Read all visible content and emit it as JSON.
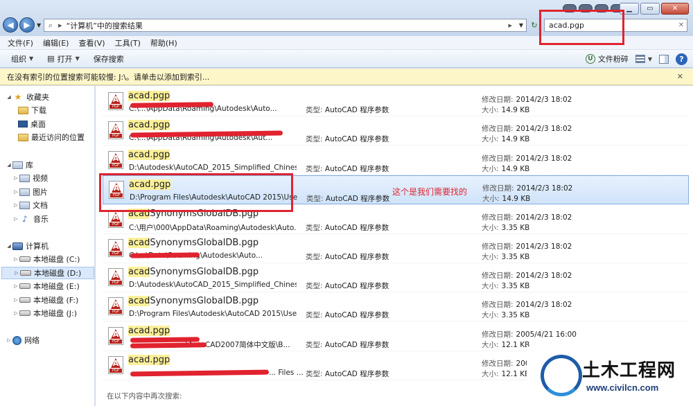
{
  "address": {
    "path": "“计算机”中的搜索结果"
  },
  "search": {
    "value": "acad.pgp"
  },
  "menu": [
    "文件(F)",
    "编辑(E)",
    "查看(V)",
    "工具(T)",
    "帮助(H)"
  ],
  "toolbar": {
    "organize": "组织",
    "open": "打开",
    "save_search": "保存搜索",
    "shredder": "文件粉碎"
  },
  "infobar": {
    "text": "在没有索引的位置搜索可能较慢: J:\\。请单击以添加到索引..."
  },
  "nav": {
    "favorites": "收藏夹",
    "downloads": "下载",
    "desktop": "桌面",
    "recent": "最近访问的位置",
    "libraries": "库",
    "videos": "视频",
    "pictures": "图片",
    "documents": "文档",
    "music": "音乐",
    "computer": "计算机",
    "drive_c": "本地磁盘 (C:)",
    "drive_d": "本地磁盘 (D:)",
    "drive_e": "本地磁盘 (E:)",
    "drive_f": "本地磁盘 (F:)",
    "drive_j": "本地磁盘 (J:)",
    "network": "网络"
  },
  "labels": {
    "type": "类型:",
    "modified": "修改日期:",
    "size": "大小:"
  },
  "results": [
    {
      "name_hl": "acad.pgp",
      "name_rest": "",
      "path": "C:\\...\\AppData\\Roaming\\Autodesk\\Auto...",
      "type": "AutoCAD 程序参数",
      "modified": "2014/2/3 18:02",
      "size": "14.9 KB"
    },
    {
      "name_hl": "acad.pgp",
      "name_rest": "",
      "path": "C:\\...\\AppData\\Roaming\\Autodesk\\Aut...",
      "type": "AutoCAD 程序参数",
      "modified": "2014/2/3 18:02",
      "size": "14.9 KB"
    },
    {
      "name_hl": "acad.pgp",
      "name_rest": "",
      "path": "D:\\Autodesk\\AutoCAD_2015_Simplified_Chinese...",
      "type": "AutoCAD 程序参数",
      "modified": "2014/2/3 18:02",
      "size": "14.9 KB"
    },
    {
      "name_hl": "acad.pgp",
      "name_rest": "",
      "path": "D:\\Program Files\\Autodesk\\AutoCAD 2015\\Use...",
      "type": "AutoCAD 程序参数",
      "modified": "2014/2/3 18:02",
      "size": "14.9 KB"
    },
    {
      "name_hl": "acad",
      "name_rest": "SynonymsGlobalDB.pgp",
      "path": "C:\\用户\\000\\AppData\\Roaming\\Autodesk\\Auto...",
      "type": "AutoCAD 程序参数",
      "modified": "2014/2/3 18:02",
      "size": "3.35 KB"
    },
    {
      "name_hl": "acad",
      "name_rest": "SynonymsGlobalDB.pgp",
      "path": "C:\\...\\Data\\Roaming\\Autodesk\\Auto...",
      "type": "AutoCAD 程序参数",
      "modified": "2014/2/3 18:02",
      "size": "3.35 KB"
    },
    {
      "name_hl": "acad",
      "name_rest": "SynonymsGlobalDB.pgp",
      "path": "D:\\Autodesk\\AutoCAD_2015_Simplified_Chinese...",
      "type": "AutoCAD 程序参数",
      "modified": "2014/2/3 18:02",
      "size": "3.35 KB"
    },
    {
      "name_hl": "acad",
      "name_rest": "SynonymsGlobalDB.pgp",
      "path": "D:\\Program Files\\Autodesk\\AutoCAD 2015\\Use...",
      "type": "AutoCAD 程序参数",
      "modified": "2014/2/3 18:02",
      "size": "3.35 KB"
    },
    {
      "name_hl": "acad.pgp",
      "name_rest": "",
      "path": "...\\AutoCAD2007简体中文版\\B...",
      "type": "AutoCAD 程序参数",
      "modified": "2005/4/21 16:00",
      "size": "12.1 KB"
    },
    {
      "name_hl": "acad.pgp",
      "name_rest": "",
      "path": "... Files ...",
      "type": "AutoCAD 程序参数",
      "modified": "200...",
      "size": "12.1 KB"
    }
  ],
  "annotation": "这个是我们需要找的",
  "search_again": "在以下内容中再次搜索:",
  "watermark": {
    "title": "土木工程网",
    "url": "www.civilcn.com"
  },
  "colors": {
    "highlight": "#fbf09a",
    "annotation_red": "#e0232f",
    "selection": "#cfe3fa"
  }
}
